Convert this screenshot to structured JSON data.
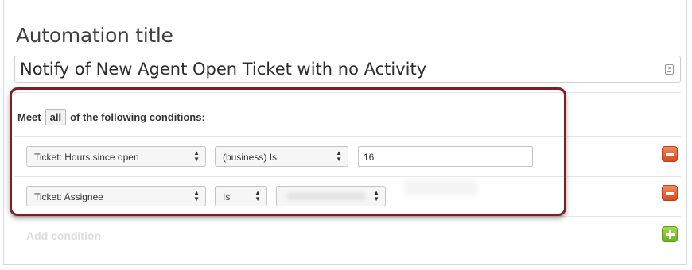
{
  "automation": {
    "title_label": "Automation title",
    "title_value": "Notify of New Agent Open Ticket with no Activity"
  },
  "conditions": {
    "meet_prefix": "Meet",
    "match_mode": "all",
    "meet_suffix": "of the following conditions:",
    "rows": [
      {
        "field": "Ticket: Hours since open",
        "operator": "(business) Is",
        "value": "16"
      },
      {
        "field": "Ticket: Assignee",
        "operator": "Is",
        "value": ""
      }
    ],
    "add_label": "Add condition"
  },
  "colors": {
    "highlight_border": "#7a1f2a",
    "remove_button": "#e0592a",
    "add_button": "#8cc63f"
  },
  "icons": {
    "title_input_icon": "contact-card-icon",
    "remove": "minus-icon",
    "add": "plus-icon"
  }
}
